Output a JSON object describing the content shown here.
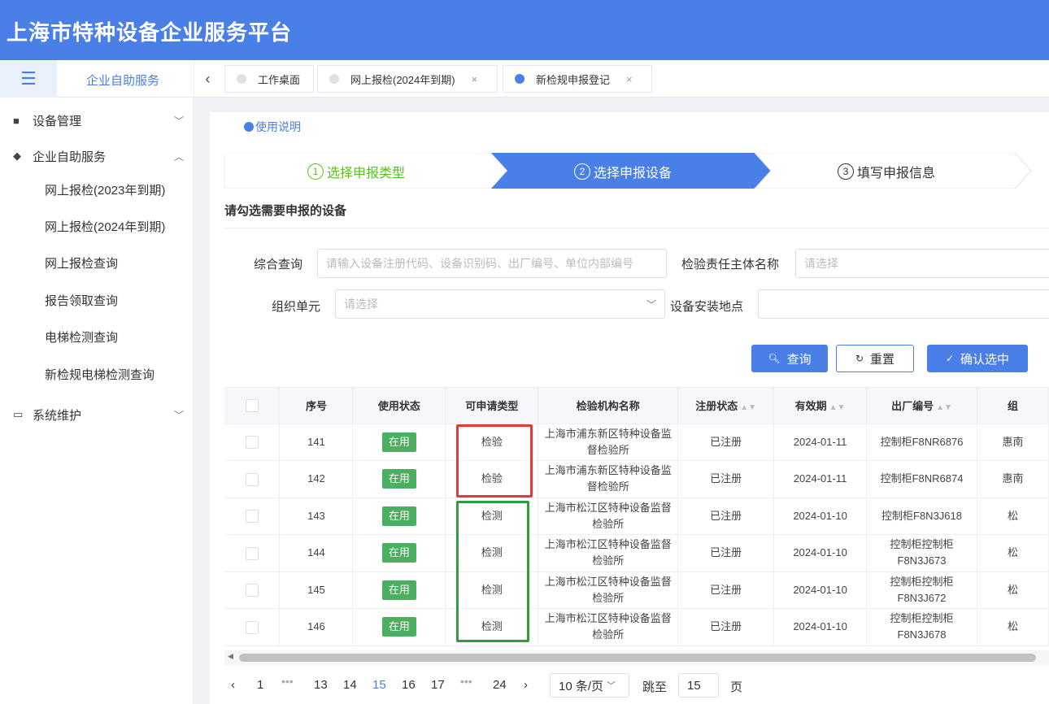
{
  "app": {
    "title": "上海市特种设备企业服务平台"
  },
  "topbar": {
    "crumb": "企业自助服务",
    "tabs": [
      {
        "label": "工作桌面",
        "closable": false,
        "active": false
      },
      {
        "label": "网上报检(2024年到期)",
        "closable": true,
        "active": false
      },
      {
        "label": "新检规申报登记",
        "closable": true,
        "active": true
      }
    ],
    "close_glyph": "×"
  },
  "sidebar": {
    "groups": [
      {
        "label": "设备管理",
        "expanded": false
      },
      {
        "label": "企业自助服务",
        "expanded": true,
        "items": [
          "网上报检(2023年到期)",
          "网上报检(2024年到期)",
          "网上报检查询",
          "报告领取查询",
          "电梯检测查询",
          "新检规电梯检测查询"
        ]
      },
      {
        "label": "系统维护",
        "expanded": false
      }
    ]
  },
  "main": {
    "help_link": "使用说明",
    "steps": [
      {
        "num": "1",
        "label": "选择申报类型",
        "state": "done"
      },
      {
        "num": "2",
        "label": "选择申报设备",
        "state": "active"
      },
      {
        "num": "3",
        "label": "填写申报信息",
        "state": "pending"
      }
    ],
    "section_title": "请勾选需要申报的设备",
    "filters": {
      "query_label": "综合查询",
      "query_placeholder": "请输入设备注册代码、设备识别码、出厂编号、单位内部编号",
      "inspector_label": "检验责任主体名称",
      "inspector_placeholder": "请选择",
      "org_label": "组织单元",
      "org_placeholder": "请选择",
      "location_label": "设备安装地点",
      "location_value": ""
    },
    "buttons": {
      "search": "查询",
      "reset": "重置",
      "confirm": "确认选中"
    }
  },
  "table": {
    "columns": [
      "序号",
      "使用状态",
      "可申请类型",
      "检验机构名称",
      "注册状态",
      "有效期",
      "出厂编号",
      "组"
    ],
    "rows": [
      {
        "no": "141",
        "status": "在用",
        "type": "检验",
        "org": "上海市浦东新区特种设备监督检验所",
        "reg": "已注册",
        "valid": "2024-01-11",
        "serial": "控制柜F8NR6876",
        "extra": "惠南"
      },
      {
        "no": "142",
        "status": "在用",
        "type": "检验",
        "org": "上海市浦东新区特种设备监督检验所",
        "reg": "已注册",
        "valid": "2024-01-11",
        "serial": "控制柜F8NR6874",
        "extra": "惠南"
      },
      {
        "no": "143",
        "status": "在用",
        "type": "检测",
        "org": "上海市松江区特种设备监督检验所",
        "reg": "已注册",
        "valid": "2024-01-10",
        "serial": "控制柜F8N3J618",
        "extra": "松"
      },
      {
        "no": "144",
        "status": "在用",
        "type": "检测",
        "org": "上海市松江区特种设备监督检验所",
        "reg": "已注册",
        "valid": "2024-01-10",
        "serial": "控制柜控制柜F8N3J673",
        "extra": "松"
      },
      {
        "no": "145",
        "status": "在用",
        "type": "检测",
        "org": "上海市松江区特种设备监督检验所",
        "reg": "已注册",
        "valid": "2024-01-10",
        "serial": "控制柜控制柜F8N3J672",
        "extra": "松"
      },
      {
        "no": "146",
        "status": "在用",
        "type": "检测",
        "org": "上海市松江区特种设备监督检验所",
        "reg": "已注册",
        "valid": "2024-01-10",
        "serial": "控制柜控制柜F8N3J678",
        "extra": "松"
      }
    ]
  },
  "pagination": {
    "prev": "‹",
    "next": "›",
    "ellipsis": "•••",
    "pages": [
      "1",
      "13",
      "14",
      "15",
      "16",
      "17",
      "24"
    ],
    "current": "15",
    "page_size": "10 条/页",
    "jump_label": "跳至",
    "jump_value": "15",
    "page_unit": "页"
  },
  "colors": {
    "primary": "#4a7fe8",
    "step_done": "#52c41a",
    "status_tag": "#4cae61",
    "highlight_red": "#e53935",
    "highlight_green": "#2e9e3b"
  }
}
